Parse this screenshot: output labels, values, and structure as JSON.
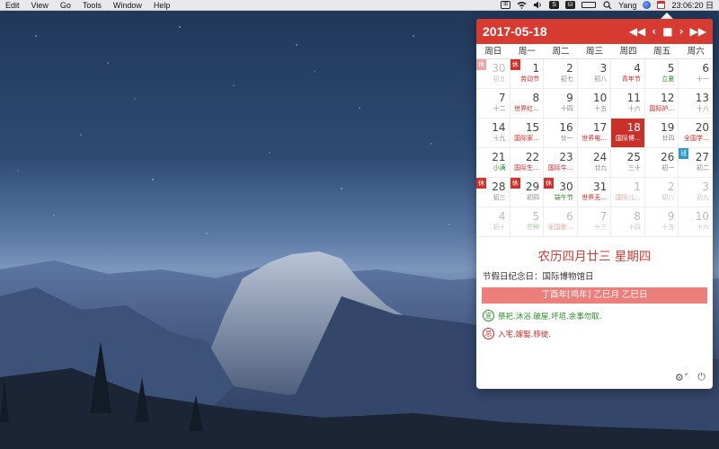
{
  "menubar": {
    "menus": [
      "Edit",
      "View",
      "Go",
      "Tools",
      "Window",
      "Help"
    ],
    "status_icons": [
      "input-method-icon",
      "wifi-icon",
      "volume-icon",
      "s-app-icon",
      "dark-app-icon",
      "battery-icon",
      "search-icon"
    ],
    "input_method_glyph": "⊞",
    "s_app_glyph": "S",
    "dark_app_glyph": "⛁",
    "user": "Yang",
    "clock": "23:06:20 日"
  },
  "calendar": {
    "header_title": "2017-05-18",
    "nav": {
      "prev_year": "◀◀",
      "prev_month": "‹",
      "today": "■",
      "next_month": "›",
      "next_year": "▶▶"
    },
    "weekdays": [
      "周日",
      "周一",
      "周二",
      "周三",
      "周四",
      "周五",
      "周六"
    ],
    "days": [
      {
        "num": "30",
        "sub": "初五",
        "dim": true,
        "badge": "休",
        "badge_faded": true
      },
      {
        "num": "1",
        "sub": "劳动节",
        "sub_color": "red",
        "badge": "休"
      },
      {
        "num": "2",
        "sub": "初七"
      },
      {
        "num": "3",
        "sub": "初八"
      },
      {
        "num": "4",
        "sub": "青年节",
        "sub_color": "red"
      },
      {
        "num": "5",
        "sub": "立夏",
        "sub_color": "green"
      },
      {
        "num": "6",
        "sub": "十一"
      },
      {
        "num": "7",
        "sub": "十二"
      },
      {
        "num": "8",
        "sub": "世界红…",
        "sub_color": "red"
      },
      {
        "num": "9",
        "sub": "十四"
      },
      {
        "num": "10",
        "sub": "十五"
      },
      {
        "num": "11",
        "sub": "十六"
      },
      {
        "num": "12",
        "sub": "国际护…",
        "sub_color": "red"
      },
      {
        "num": "13",
        "sub": "十八"
      },
      {
        "num": "14",
        "sub": "十九"
      },
      {
        "num": "15",
        "sub": "国际家…",
        "sub_color": "red"
      },
      {
        "num": "16",
        "sub": "廿一"
      },
      {
        "num": "17",
        "sub": "世界电…",
        "sub_color": "red"
      },
      {
        "num": "18",
        "sub": "国际博…",
        "selected": true
      },
      {
        "num": "19",
        "sub": "廿四"
      },
      {
        "num": "20",
        "sub": "全国学…",
        "sub_color": "red"
      },
      {
        "num": "21",
        "sub": "小满",
        "sub_color": "green"
      },
      {
        "num": "22",
        "sub": "国际生…",
        "sub_color": "red"
      },
      {
        "num": "23",
        "sub": "国际牛…",
        "sub_color": "red"
      },
      {
        "num": "24",
        "sub": "廿九"
      },
      {
        "num": "25",
        "sub": "三十"
      },
      {
        "num": "26",
        "sub": "初一"
      },
      {
        "num": "27",
        "sub": "初二",
        "badge": "班",
        "badge_work": true
      },
      {
        "num": "28",
        "sub": "初三",
        "badge": "休"
      },
      {
        "num": "29",
        "sub": "初四",
        "badge": "休"
      },
      {
        "num": "30",
        "sub": "端午节",
        "sub_color": "green",
        "badge": "休"
      },
      {
        "num": "31",
        "sub": "世界无…",
        "sub_color": "red"
      },
      {
        "num": "1",
        "sub": "国际儿…",
        "sub_color": "red",
        "dim": true
      },
      {
        "num": "2",
        "sub": "初八",
        "dim": true
      },
      {
        "num": "3",
        "sub": "初九",
        "dim": true
      },
      {
        "num": "4",
        "sub": "初十",
        "dim": true
      },
      {
        "num": "5",
        "sub": "芒种",
        "sub_color": "green",
        "dim": true
      },
      {
        "num": "6",
        "sub": "全国爱…",
        "sub_color": "red",
        "dim": true
      },
      {
        "num": "7",
        "sub": "十三",
        "dim": true
      },
      {
        "num": "8",
        "sub": "十四",
        "dim": true
      },
      {
        "num": "9",
        "sub": "十五",
        "dim": true
      },
      {
        "num": "10",
        "sub": "十六",
        "dim": true
      }
    ],
    "lunar_line": "农历四月廿三 星期四",
    "festival_line": "节假日纪念日：国际博物馆日",
    "ganzhi": "丁酉年[鸡年] 乙巳月 乙巳日",
    "yi_label": "宜",
    "yi_text": "祭祀.沐浴.破屋.坏垣.余事勿取.",
    "ji_label": "忌",
    "ji_text": "入宅.嫁娶.移徙.",
    "settings_glyph": "⚙˅",
    "power_glyph": "⏻"
  },
  "colors": {
    "header_red": "#d73a31",
    "selected_red": "#c9302a",
    "holiday_badge": "#d0312a",
    "work_badge": "#2a9bc9",
    "ganzhi_bar": "#ec7f7b",
    "good_green": "#2a8f2a"
  }
}
